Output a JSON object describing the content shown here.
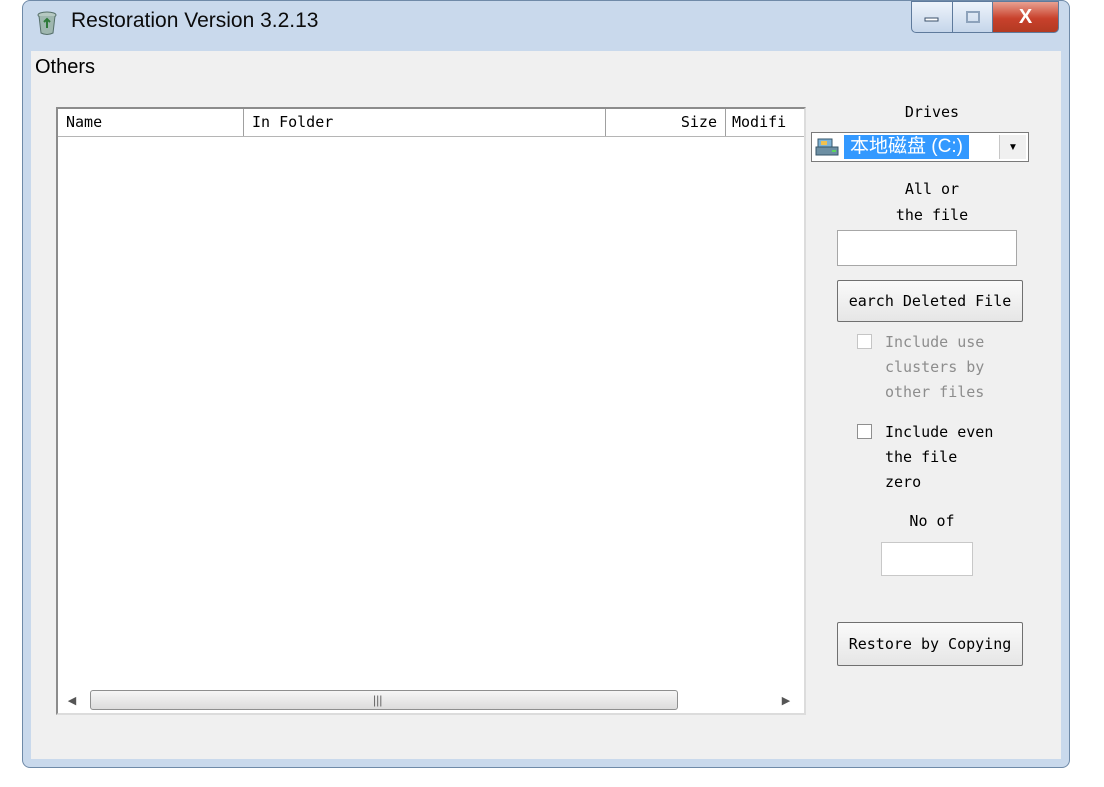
{
  "window": {
    "title": "Restoration Version 3.2.13"
  },
  "menu": {
    "others": "Others"
  },
  "list": {
    "columns": [
      "Name",
      "In Folder",
      "Size",
      "Modifi"
    ],
    "scroll_grip": "|||"
  },
  "sidebar": {
    "drives_label": "Drives",
    "drive_selected": "本地磁盘 (C:)",
    "filename_label_line1": "All or",
    "filename_label_line2": "the file",
    "filename_value": "",
    "search_button": "earch Deleted File",
    "include_used_clusters": {
      "label": "Include use\nclusters by\nother files",
      "checked": false,
      "enabled": false
    },
    "include_zero": {
      "label": "Include even\nthe file\nzero",
      "checked": false,
      "enabled": true
    },
    "count_label": "No of",
    "count_value": "",
    "restore_button": "Restore by Copying"
  },
  "titlebar": {
    "close_glyph": "X"
  }
}
